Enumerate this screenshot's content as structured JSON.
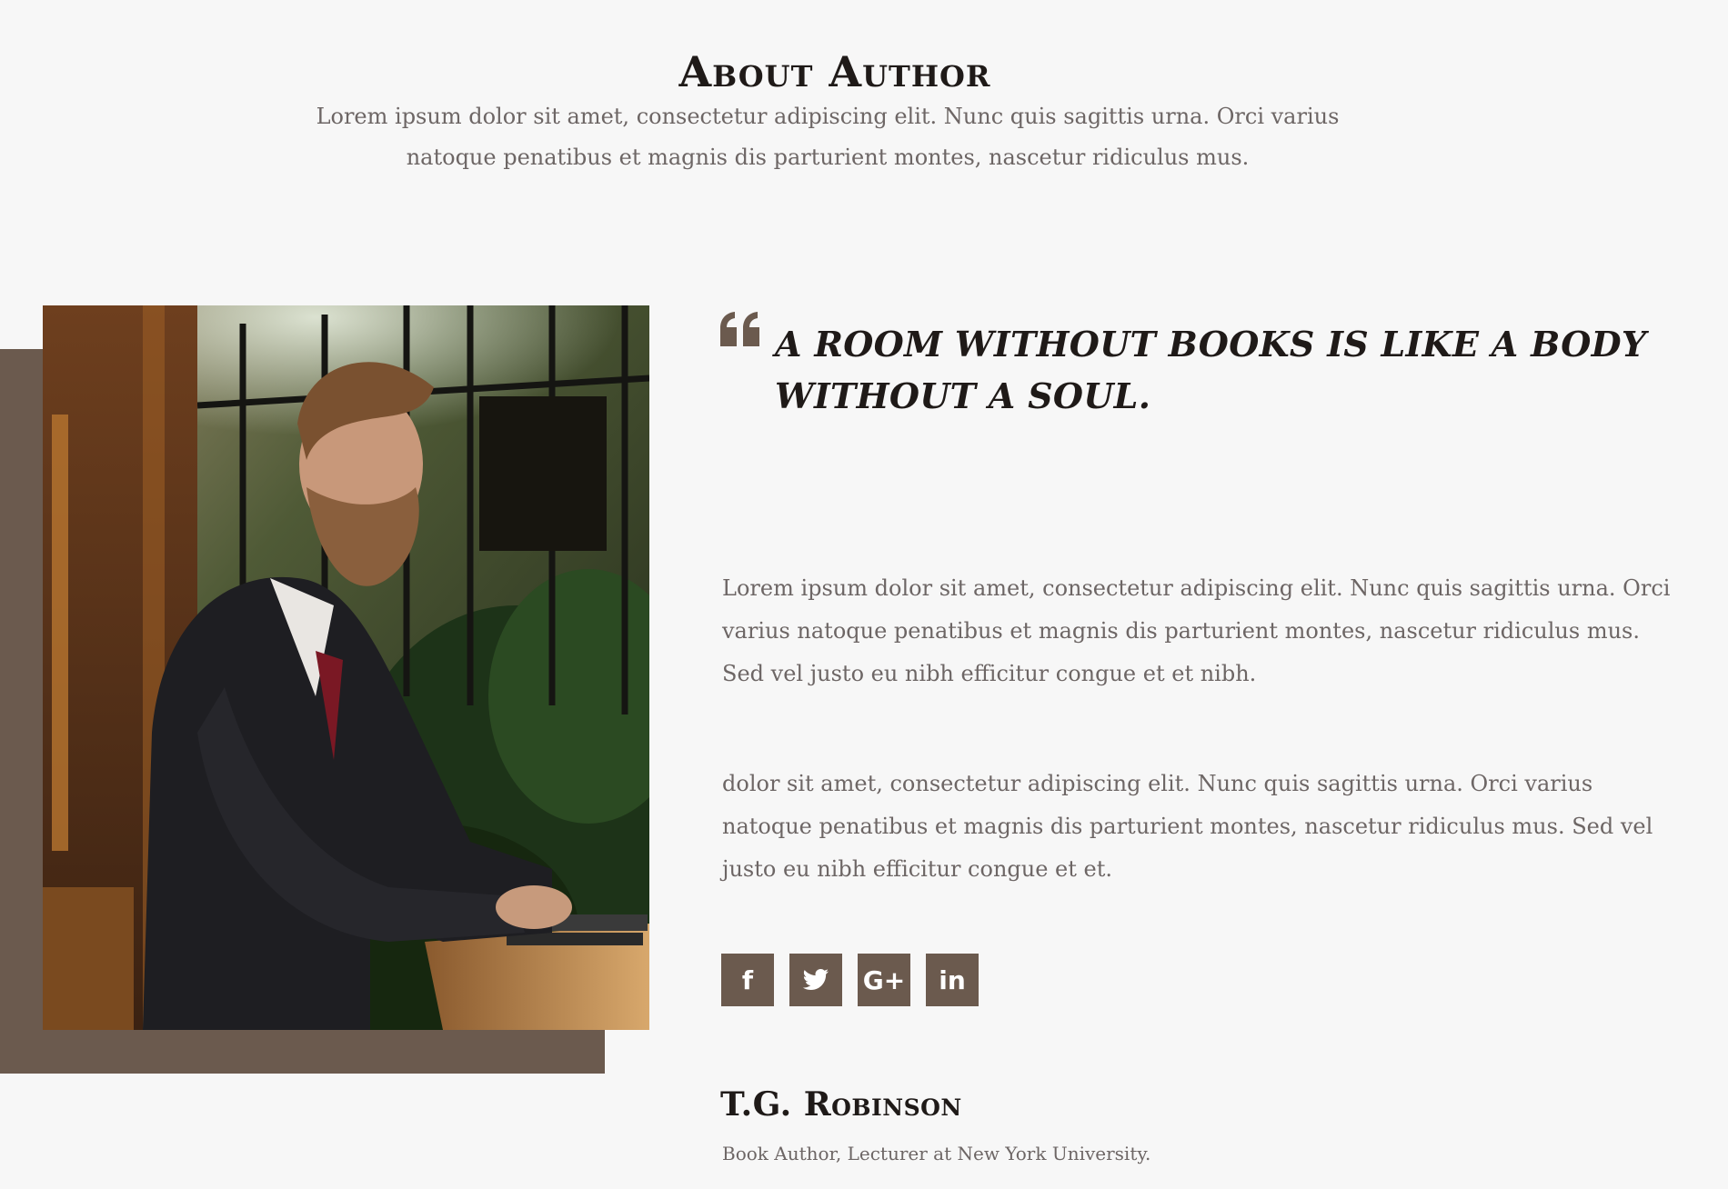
{
  "section": {
    "title": "About Author",
    "intro": "Lorem ipsum dolor sit amet, consectetur adipiscing elit. Nunc quis sagittis urna. Orci varius natoque penatibus et magnis dis parturient montes, nascetur ridiculus mus."
  },
  "photo": {
    "icon": "author-photo",
    "accent_color": "#6b5a4e"
  },
  "quote": {
    "icon": "quote-icon",
    "text": "A room without books is like a body without a soul."
  },
  "paragraphs": [
    "Lorem ipsum dolor sit amet, consectetur adipiscing elit. Nunc quis sagittis urna. Orci varius natoque penatibus et magnis dis parturient montes, nascetur ridiculus mus. Sed vel justo eu nibh efficitur congue et et nibh.",
    "dolor sit amet, consectetur adipiscing elit. Nunc quis sagittis urna. Orci varius natoque penatibus et magnis dis parturient montes, nascetur ridiculus mus. Sed vel justo eu nibh efficitur congue et et."
  ],
  "social": [
    {
      "icon": "facebook-icon",
      "label": "f"
    },
    {
      "icon": "twitter-icon",
      "label": ""
    },
    {
      "icon": "google-plus-icon",
      "label": "G+"
    },
    {
      "icon": "linkedin-icon",
      "label": "in"
    }
  ],
  "author": {
    "name": "T.G. Robinson",
    "role": "Book Author, Lecturer at New York University."
  },
  "colors": {
    "background": "#f7f7f7",
    "accent": "#6b5a4e",
    "heading": "#1f1a18",
    "body_text": "#6d6665"
  }
}
